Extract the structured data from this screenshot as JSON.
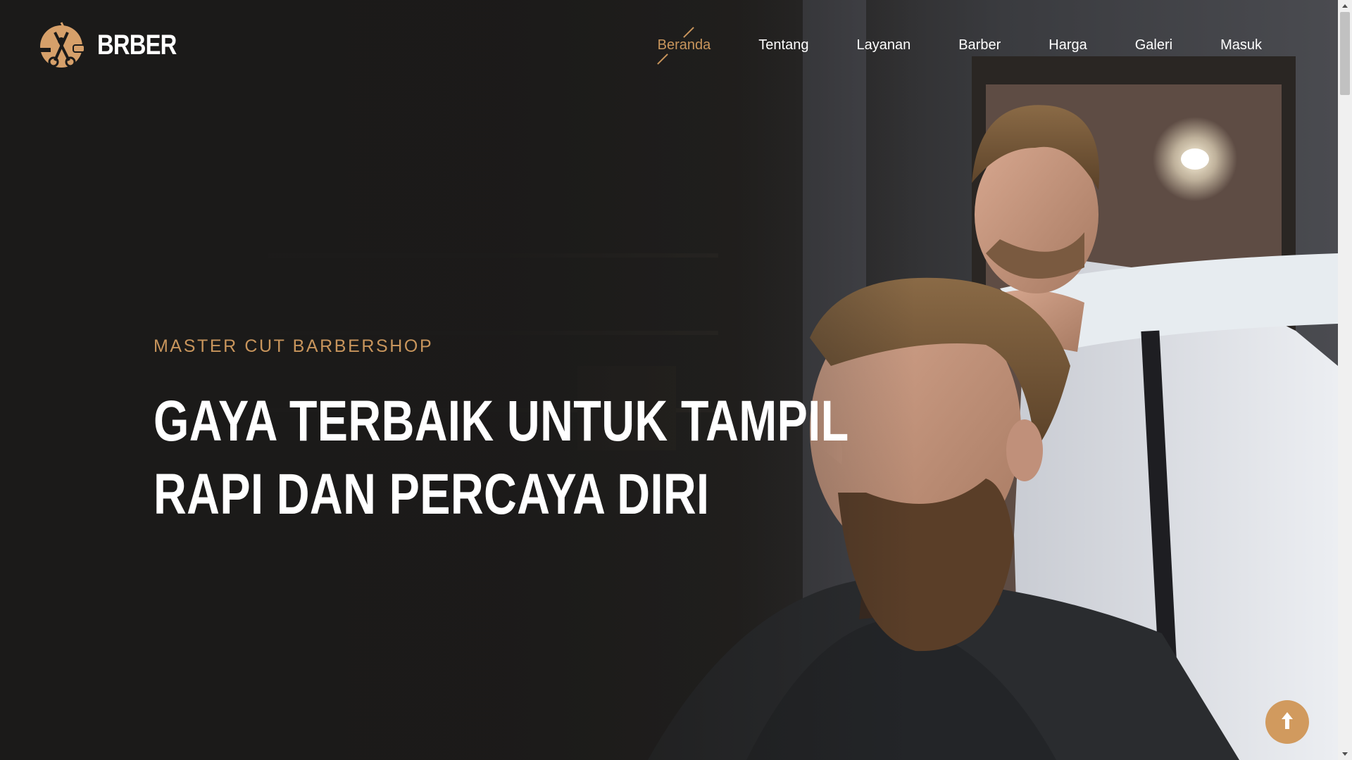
{
  "brand": {
    "name": "BRBER",
    "logo_icon": "scissors-comb-logo-icon"
  },
  "nav": {
    "items": [
      {
        "label": "Beranda",
        "active": true
      },
      {
        "label": "Tentang",
        "active": false
      },
      {
        "label": "Layanan",
        "active": false
      },
      {
        "label": "Barber",
        "active": false
      },
      {
        "label": "Harga",
        "active": false
      },
      {
        "label": "Galeri",
        "active": false
      },
      {
        "label": "Masuk",
        "active": false
      }
    ]
  },
  "hero": {
    "subtitle": "MASTER CUT BARBERSHOP",
    "title_line_1": "GAYA TERBAIK UNTUK TAMPIL",
    "title_line_2": "RAPI DAN PERCAYA DIRI",
    "background_image": "barber-styling-bearded-client-photo"
  },
  "back_to_top": {
    "icon": "arrow-up-icon"
  },
  "colors": {
    "accent": "#c8955c",
    "background": "#1b1a19",
    "text": "#ffffff",
    "button": "#d19a5e"
  }
}
